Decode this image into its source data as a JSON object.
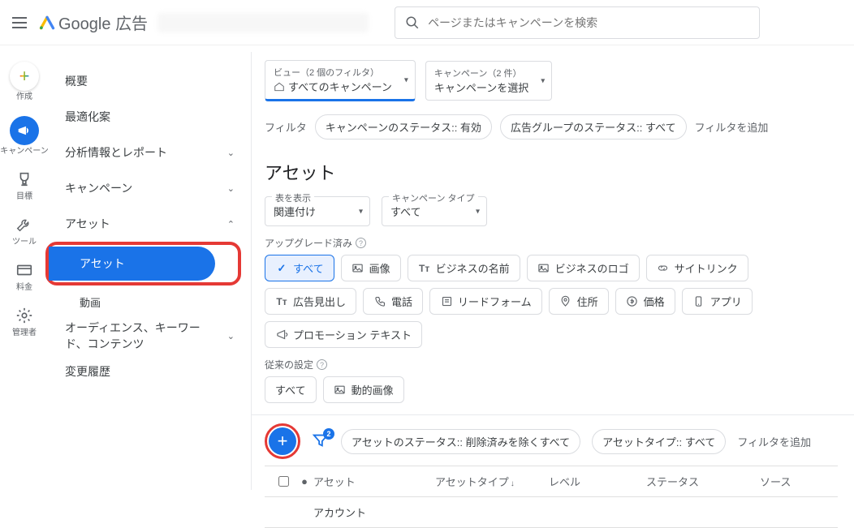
{
  "header": {
    "product": "Google",
    "suffix": "広告",
    "search_placeholder": "ページまたはキャンペーンを検索"
  },
  "rail": [
    {
      "label": "作成",
      "icon": "plus"
    },
    {
      "label": "キャンペーン",
      "icon": "megaphone",
      "active": true
    },
    {
      "label": "目標",
      "icon": "trophy"
    },
    {
      "label": "ツール",
      "icon": "wrench"
    },
    {
      "label": "料金",
      "icon": "card"
    },
    {
      "label": "管理者",
      "icon": "gear"
    }
  ],
  "sidebar": {
    "overview": "概要",
    "optimization": "最適化案",
    "insights": "分析情報とレポート",
    "campaigns": "キャンペーン",
    "assets": "アセット",
    "assets_active": "アセット",
    "video": "動画",
    "audience": "オーディエンス、キーワード、コンテンツ",
    "history": "変更履歴"
  },
  "view_selector": {
    "view_lbl": "ビュー（2 個のフィルタ）",
    "view_val": "すべてのキャンペーン",
    "camp_lbl": "キャンペーン（2 件）",
    "camp_val": "キャンペーンを選択"
  },
  "filter_row": {
    "label": "フィルタ",
    "chip1": "キャンペーンのステータス:: 有効",
    "chip2": "広告グループのステータス:: すべて",
    "add": "フィルタを追加"
  },
  "section_title": "アセット",
  "selectors": {
    "table_lbl": "表を表示",
    "table_val": "関連付け",
    "ctype_lbl": "キャンペーン タイプ",
    "ctype_val": "すべて"
  },
  "upgraded_lbl": "アップグレード済み",
  "upgraded_chips": [
    {
      "label": "すべて",
      "icon": "check",
      "on": true
    },
    {
      "label": "画像",
      "icon": "image"
    },
    {
      "label": "ビジネスの名前",
      "icon": "tt"
    },
    {
      "label": "ビジネスのロゴ",
      "icon": "image"
    },
    {
      "label": "サイトリンク",
      "icon": "link"
    },
    {
      "label": "広告見出し",
      "icon": "tt"
    },
    {
      "label": "電話",
      "icon": "phone"
    },
    {
      "label": "リードフォーム",
      "icon": "form"
    },
    {
      "label": "住所",
      "icon": "pin"
    },
    {
      "label": "価格",
      "icon": "price"
    },
    {
      "label": "アプリ",
      "icon": "app"
    },
    {
      "label": "プロモーション テキスト",
      "icon": "promo"
    }
  ],
  "legacy_lbl": "従来の設定",
  "legacy_chips": [
    {
      "label": "すべて"
    },
    {
      "label": "動的画像",
      "icon": "image"
    }
  ],
  "action_row": {
    "funnel_count": "2",
    "chipA": "アセットのステータス:: 削除済みを除くすべて",
    "chipB": "アセットタイプ:: すべて",
    "add": "フィルタを追加"
  },
  "table": {
    "headers": {
      "asset": "アセット",
      "type": "アセットタイプ",
      "level": "レベル",
      "status": "ステータス",
      "source": "ソース"
    },
    "row1_asset": "アカウント"
  }
}
